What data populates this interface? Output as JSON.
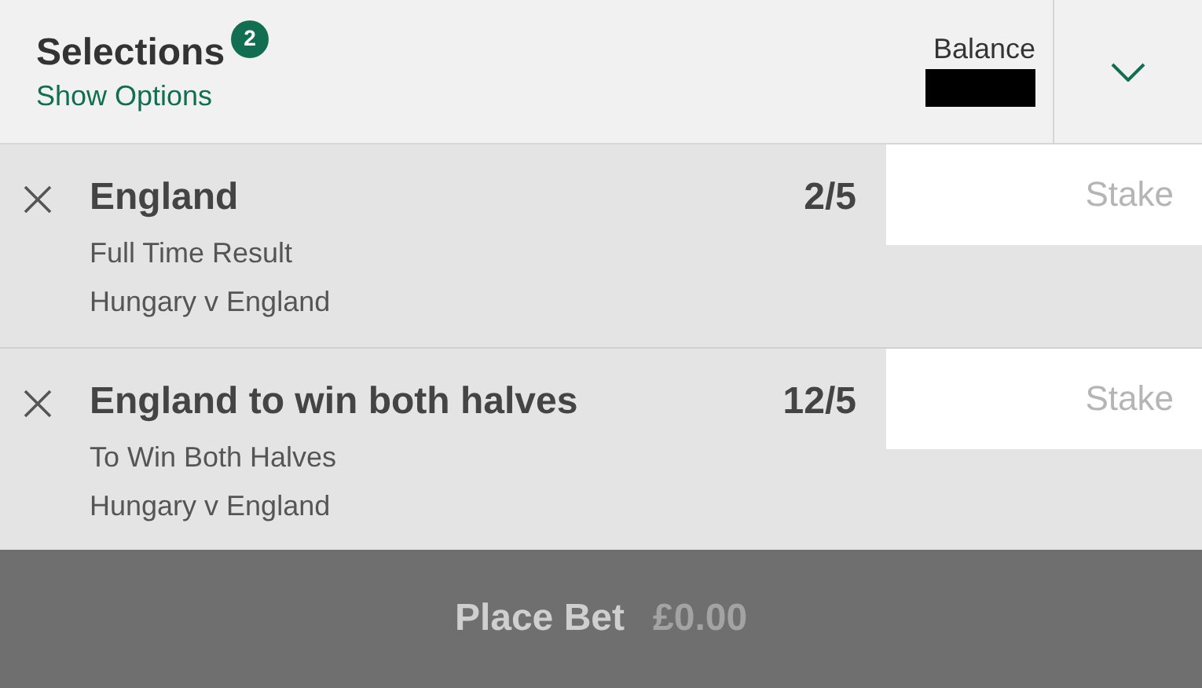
{
  "header": {
    "title": "Selections",
    "count": "2",
    "link": "Show Options",
    "balance_label": "Balance"
  },
  "selections": [
    {
      "name": "England",
      "odds": "2/5",
      "market": "Full Time Result",
      "event": "Hungary v England",
      "stake_placeholder": "Stake"
    },
    {
      "name": "England to win both halves",
      "odds": "12/5",
      "market": "To Win Both Halves",
      "event": "Hungary v England",
      "stake_placeholder": "Stake"
    }
  ],
  "place_bet": {
    "label": "Place Bet",
    "amount": "£0.00"
  }
}
